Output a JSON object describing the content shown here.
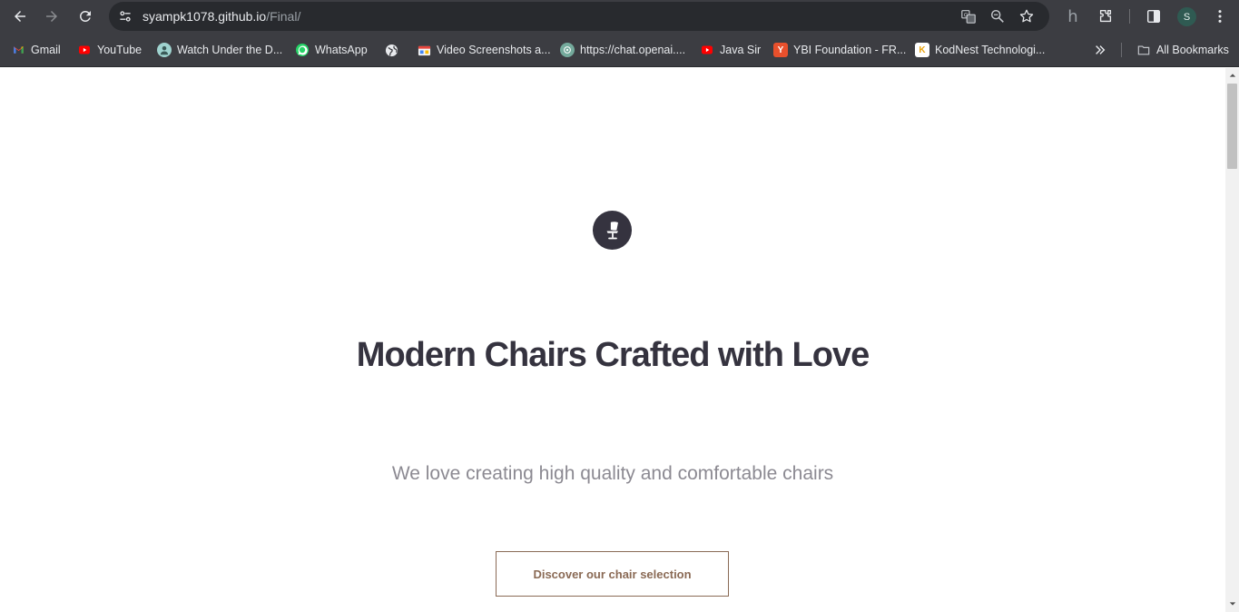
{
  "browser": {
    "url_host": "syampk1078.github.io",
    "url_path": "/Final/",
    "profile_initial": "S",
    "extension_letter": "h"
  },
  "bookmarks": {
    "items": [
      {
        "label": "Gmail",
        "icon": "gmail-icon"
      },
      {
        "label": "YouTube",
        "icon": "youtube-icon"
      },
      {
        "label": "Watch Under the D...",
        "icon": "avatar-icon"
      },
      {
        "label": "WhatsApp",
        "icon": "whatsapp-icon"
      },
      {
        "label": "",
        "icon": "globe-icon"
      },
      {
        "label": "Video Screenshots a...",
        "icon": "video-screenshots-icon"
      },
      {
        "label": "https://chat.openai....",
        "icon": "openai-icon"
      },
      {
        "label": "Java Sir",
        "icon": "youtube-icon"
      },
      {
        "label": "YBI Foundation - FR...",
        "icon": "ybi-icon"
      },
      {
        "label": "KodNest Technologi...",
        "icon": "kodnest-icon"
      }
    ],
    "all_bookmarks_label": "All Bookmarks"
  },
  "page": {
    "headline": "Modern Chairs Crafted with Love",
    "subtitle": "We love creating high quality and comfortable chairs",
    "cta_label": "Discover our chair selection"
  },
  "colors": {
    "dark": "#35333f",
    "accent": "#8a6a55",
    "subtitle": "#8c8a92"
  }
}
